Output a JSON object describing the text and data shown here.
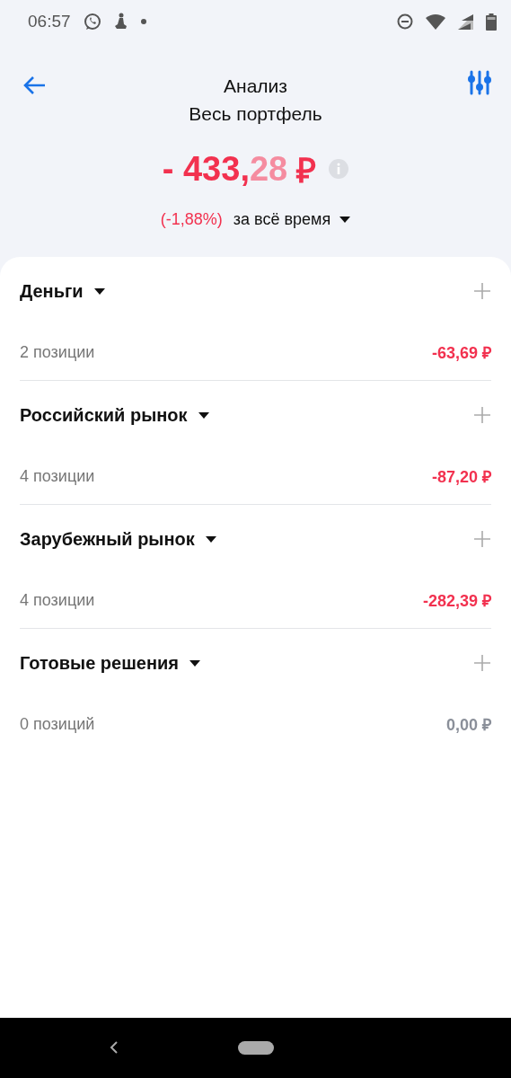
{
  "status_bar": {
    "time": "06:57"
  },
  "header": {
    "title": "Анализ",
    "subtitle": "Весь портфель"
  },
  "total": {
    "whole": "- 433,",
    "fraction": "28",
    "currency": "₽"
  },
  "change": {
    "percent": "(-1,88%)",
    "period": "за всё время"
  },
  "groups": [
    {
      "name": "Деньги",
      "positions": "2 позиции",
      "value": "-63,69 ₽",
      "color": "#f2314f"
    },
    {
      "name": "Российский рынок",
      "positions": "4 позиции",
      "value": "-87,20 ₽",
      "color": "#f2314f"
    },
    {
      "name": "Зарубежный рынок",
      "positions": "4 позиции",
      "value": "-282,39 ₽",
      "color": "#f2314f"
    },
    {
      "name": "Готовые решения",
      "positions": "0 позиций",
      "value": "0,00 ₽",
      "color": "#8a8f99"
    }
  ]
}
